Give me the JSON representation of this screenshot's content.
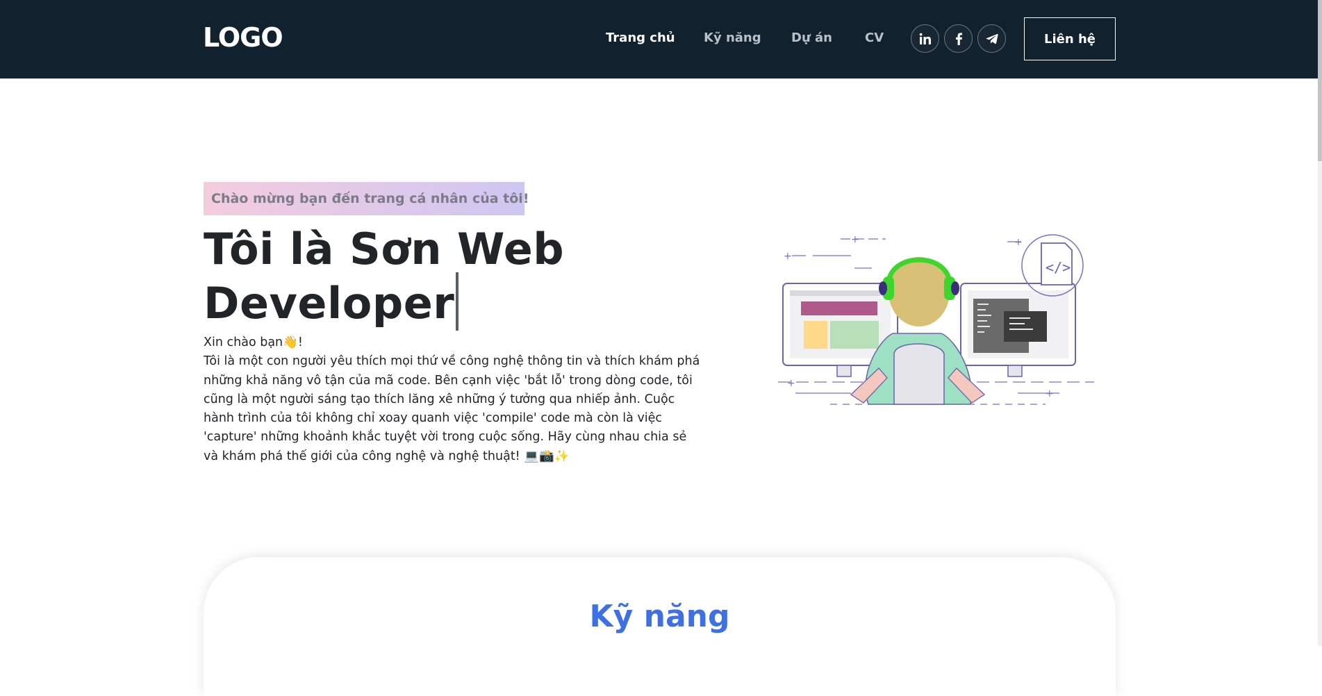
{
  "header": {
    "logo": "LOGO",
    "nav": [
      {
        "label": "Trang chủ",
        "active": true
      },
      {
        "label": "Kỹ năng",
        "active": false
      },
      {
        "label": "Dự án",
        "active": false
      },
      {
        "label": "CV",
        "active": false
      }
    ],
    "social_icons": [
      "linkedin-icon",
      "facebook-icon",
      "telegram-icon"
    ],
    "contact_button": "Liên hệ"
  },
  "hero": {
    "tagline": "Chào mừng bạn đến trang cá nhân của tôi!",
    "headline_line1": "Tôi là Sơn Web",
    "headline_line2": "Developer",
    "greeting": "Xin chào bạn👋!",
    "bio": "Tôi là một con người yêu thích mọi thứ về công nghệ thông tin và thích khám phá những khả năng vô tận của mã code. Bên cạnh việc 'bắt lỗ' trong dòng code, tôi cũng là một người sáng tạo thích lăng xê những ý tưởng qua nhiếp ảnh. Cuộc hành trình của tôi không chỉ xoay quanh việc 'compile' code mà còn là việc 'capture' những khoảnh khắc tuyệt vời trong cuộc sống. Hãy cùng nhau chia sẻ và khám phá thế giới của công nghệ và nghệ thuật! 💻📸✨"
  },
  "skills": {
    "title": "Kỹ năng"
  },
  "colors": {
    "navbar_bg": "#12212e",
    "accent_blue": "#3f6fe4",
    "headset_green": "#3dd62c"
  }
}
